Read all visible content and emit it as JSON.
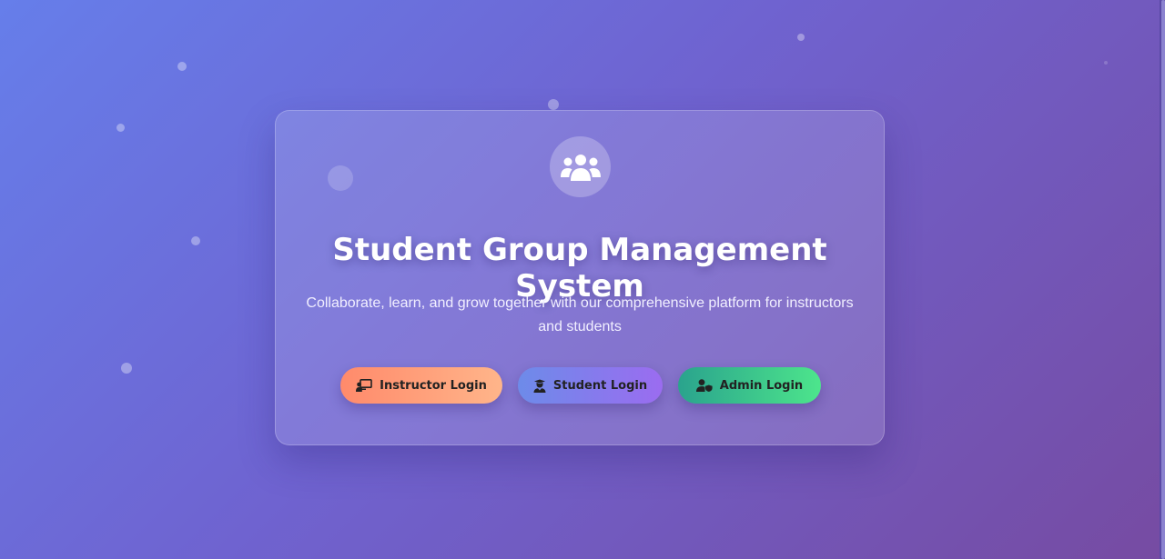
{
  "hero": {
    "title": "Student Group Management System",
    "subtitle": "Collaborate, learn, and grow together with our comprehensive platform for instructors and students",
    "logo_icon": "users-group-icon"
  },
  "buttons": {
    "instructor": {
      "label": "Instructor Login",
      "icon": "chalkboard-teacher-icon"
    },
    "student": {
      "label": "Student Login",
      "icon": "user-graduate-icon"
    },
    "admin": {
      "label": "Admin Login",
      "icon": "user-shield-icon"
    }
  },
  "colors": {
    "background_start": "#667eea",
    "background_end": "#764ba2",
    "instructor_button": "#ff8a6b",
    "student_button": "#7b7cee",
    "admin_button": "#3cc48c"
  }
}
